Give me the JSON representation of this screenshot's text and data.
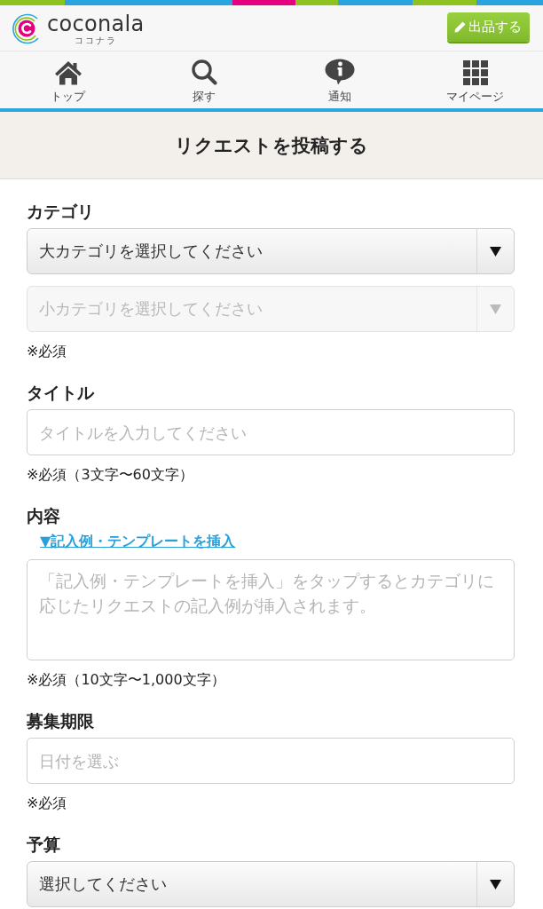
{
  "top_bar": {
    "logo": {
      "wordmark": "coconala",
      "subtitle": "ココナラ"
    },
    "post_button": {
      "label": "出品する"
    }
  },
  "nav": {
    "items": [
      {
        "label": "トップ"
      },
      {
        "label": "探す"
      },
      {
        "label": "通知"
      },
      {
        "label": "マイページ"
      }
    ]
  },
  "page_title": "リクエストを投稿する",
  "form": {
    "sections": [
      {
        "label": "カテゴリ",
        "controls": [
          {
            "kind": "select",
            "value": "大カテゴリを選択してください",
            "disabled": false
          },
          {
            "kind": "select",
            "value": "小カテゴリを選択してください",
            "disabled": true
          }
        ],
        "note": "※必須"
      },
      {
        "label": "タイトル",
        "controls": [
          {
            "kind": "input",
            "placeholder": "タイトルを入力してください",
            "disabled": false
          }
        ],
        "note": "※必須（3文字〜60文字）"
      },
      {
        "label": "内容",
        "link": "▼記入例・テンプレートを挿入",
        "controls": [
          {
            "kind": "textarea",
            "placeholder": "「記入例・テンプレートを挿入」をタップするとカテゴリに応じたリクエストの記入例が挿入されます。",
            "disabled": false
          }
        ],
        "note": "※必須（10文字〜1,000文字）"
      },
      {
        "label": "募集期限",
        "controls": [
          {
            "kind": "input",
            "placeholder": "日付を選ぶ",
            "disabled": false
          }
        ],
        "note": "※必須"
      },
      {
        "label": "予算",
        "controls": [
          {
            "kind": "select",
            "value": "選択してください",
            "disabled": false
          }
        ]
      }
    ]
  }
}
